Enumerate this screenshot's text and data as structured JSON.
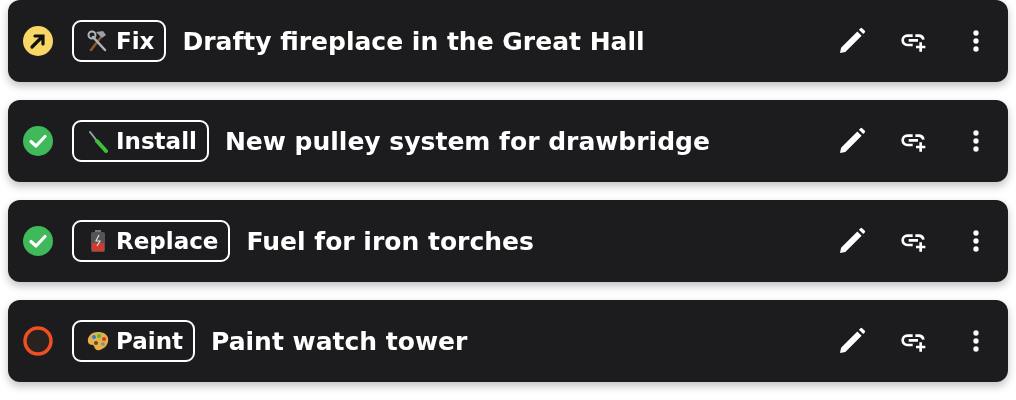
{
  "tasks": [
    {
      "kind": "in_progress",
      "tag": {
        "kind": "tools",
        "label": "Fix"
      },
      "title": "Drafty fireplace in the Great Hall"
    },
    {
      "kind": "done",
      "tag": {
        "kind": "screwdriver",
        "label": "Install"
      },
      "title": "New pulley system for drawbridge"
    },
    {
      "kind": "done",
      "tag": {
        "kind": "battery",
        "label": "Replace"
      },
      "title": "Fuel for iron torches"
    },
    {
      "kind": "todo",
      "tag": {
        "kind": "palette",
        "label": "Paint"
      },
      "title": "Paint watch tower"
    }
  ]
}
